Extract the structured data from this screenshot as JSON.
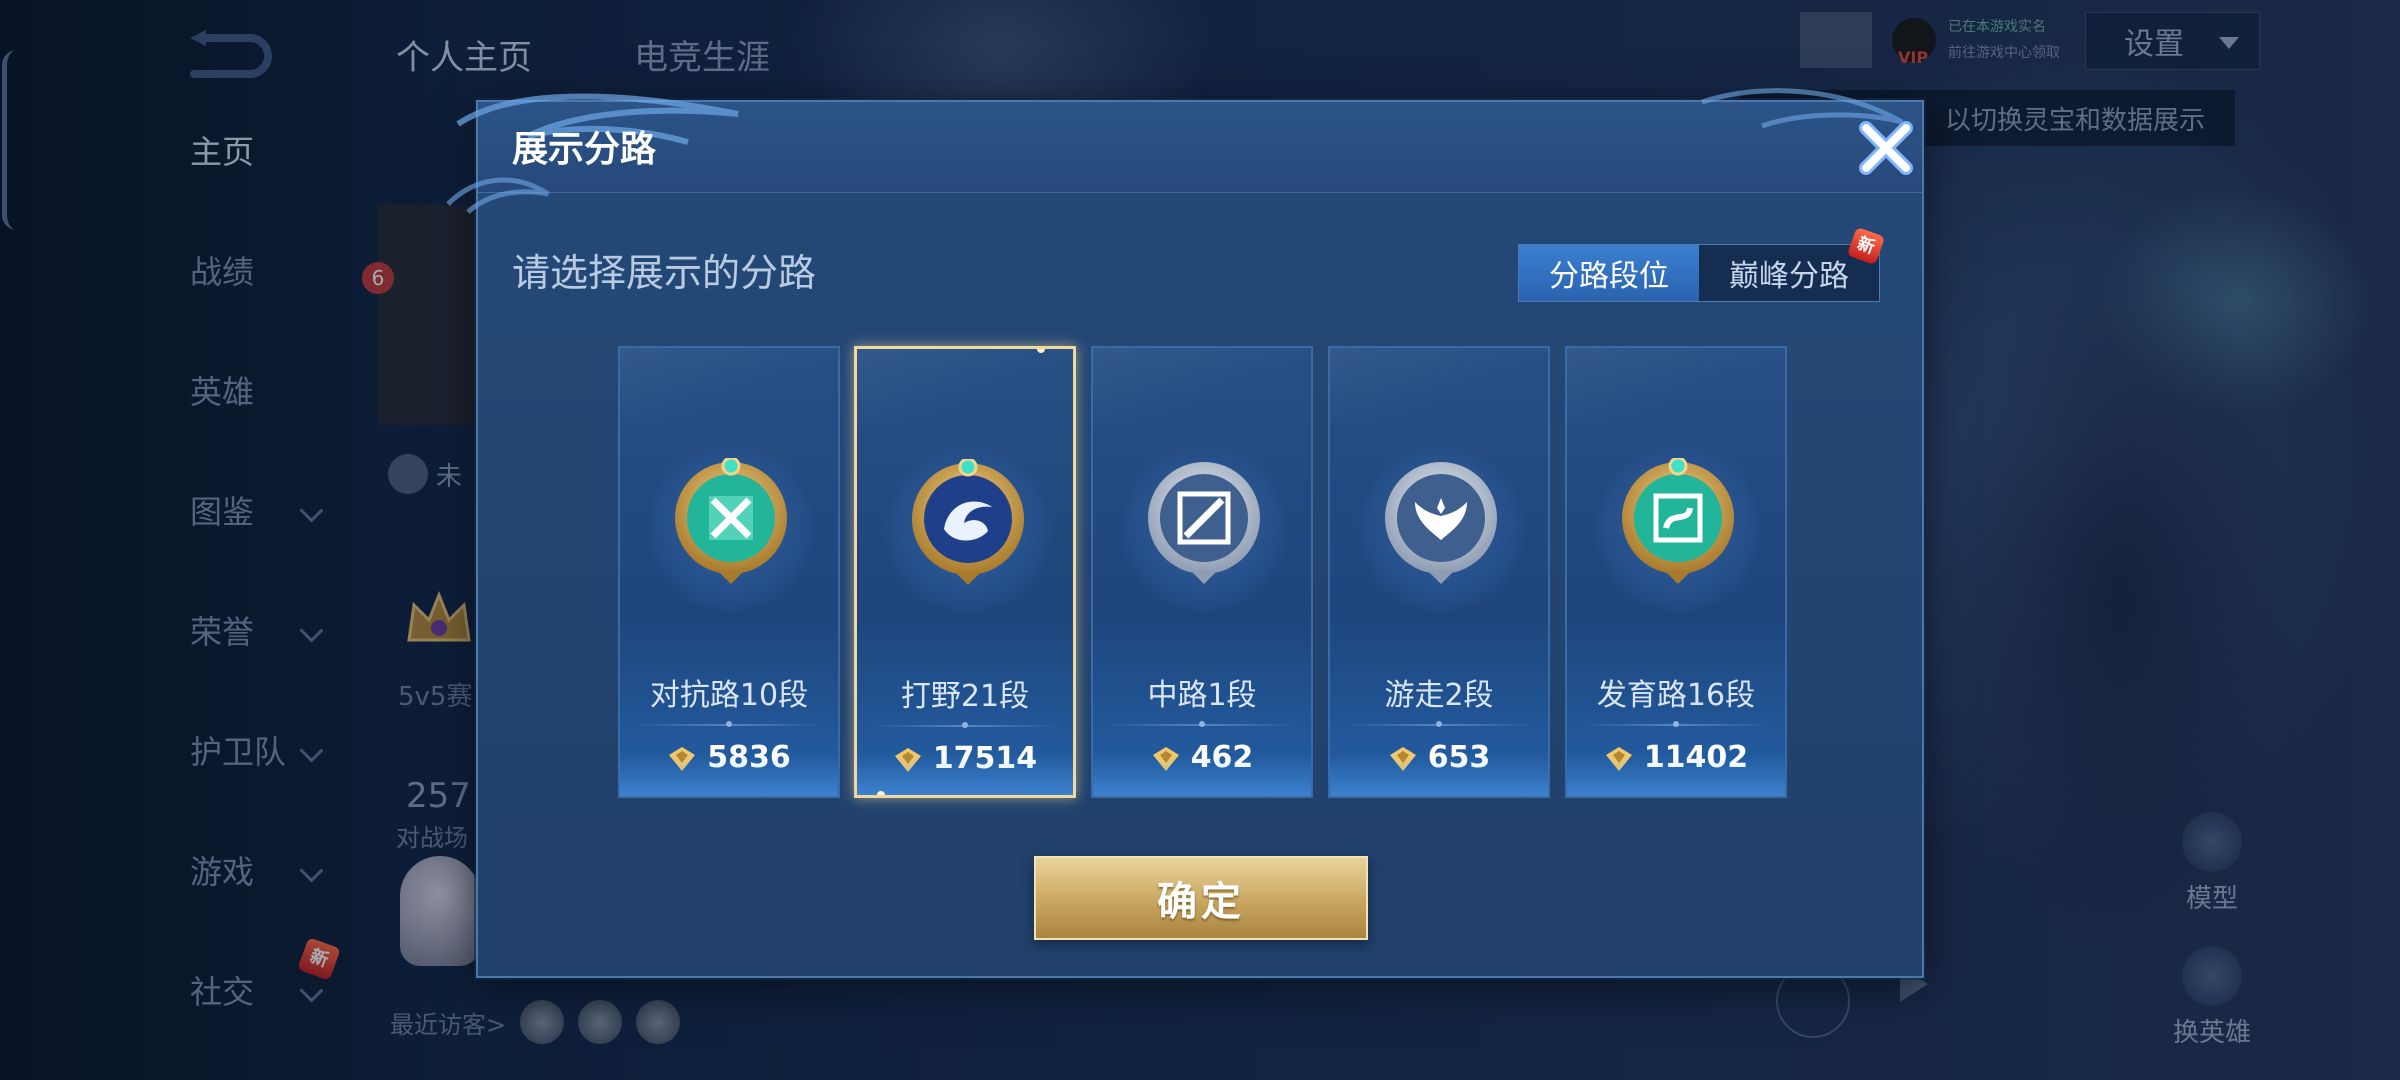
{
  "background": {
    "top_tabs": [
      {
        "label": "个人主页"
      },
      {
        "label": "电竞生涯"
      }
    ],
    "settings_label": "设置",
    "vip_text": "VIP",
    "vip_line1": "已在本游戏实名",
    "vip_line2": "前往游戏中心领取",
    "hint_text": "以切换灵宝和数据展示",
    "nav_items": [
      {
        "label": "主页",
        "has_chevron": false
      },
      {
        "label": "战绩",
        "has_chevron": false
      },
      {
        "label": "英雄",
        "has_chevron": false
      },
      {
        "label": "图鉴",
        "has_chevron": true
      },
      {
        "label": "荣誉",
        "has_chevron": true
      },
      {
        "label": "护卫队",
        "has_chevron": true
      },
      {
        "label": "游戏",
        "has_chevron": true
      },
      {
        "label": "社交",
        "has_chevron": true
      }
    ],
    "new_badge": "新",
    "profile_rank_badge": "6",
    "profile_status_fragment": "未",
    "profile_mode_fragment": "5v5赛",
    "profile_number_fragment": "257",
    "profile_battle_fragment": "对战场",
    "recent_visitors_label": "最近访客>",
    "side_buttons": [
      {
        "label": "模型"
      },
      {
        "label": "换英雄"
      }
    ]
  },
  "modal": {
    "title": "展示分路",
    "subtitle": "请选择展示的分路",
    "segment": {
      "options": [
        "分路段位",
        "巅峰分路"
      ],
      "selected_index": 0,
      "new_badge": "新"
    },
    "cards": [
      {
        "name": "对抗路10段",
        "score": "5836",
        "emblem": "clash-lane-emblem-icon",
        "tone": "gold-teal",
        "selected": false
      },
      {
        "name": "打野21段",
        "score": "17514",
        "emblem": "jungle-dragon-emblem-icon",
        "tone": "gold-blue",
        "selected": true
      },
      {
        "name": "中路1段",
        "score": "462",
        "emblem": "mid-lane-emblem-icon",
        "tone": "silver",
        "selected": false
      },
      {
        "name": "游走2段",
        "score": "653",
        "emblem": "roam-wings-emblem-icon",
        "tone": "silver",
        "selected": false
      },
      {
        "name": "发育路16段",
        "score": "11402",
        "emblem": "farm-lane-emblem-icon",
        "tone": "gold-teal",
        "selected": false
      }
    ],
    "confirm_label": "确定"
  },
  "colors": {
    "accent_blue": "#3b7fd0",
    "gold": "#c9a660",
    "selected_border": "#f0d9a0"
  }
}
